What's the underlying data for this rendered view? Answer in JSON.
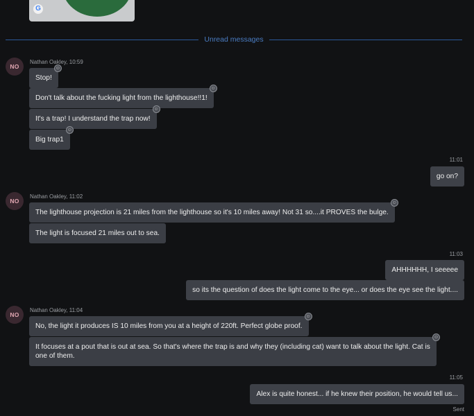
{
  "unread_label": "Unread messages",
  "top_card": {
    "icon": "G"
  },
  "groups": [
    {
      "avatar": "NO",
      "meta": "Nathan Oakley, 10:59",
      "messages": [
        "Stop!",
        "Don't talk about the fucking light from the lighthouse!!1!",
        "It's a trap! I understand the trap now!",
        "Big trap1"
      ]
    },
    {
      "time": "11:01",
      "messages": [
        "go on?"
      ]
    },
    {
      "avatar": "NO",
      "meta": "Nathan Oakley, 11:02",
      "messages": [
        "The lighthouse projection is 21 miles from the lighthouse so it's 10 miles away! Not 31 so....it PROVES the bulge.",
        "The light is focused 21 miles out to sea."
      ]
    },
    {
      "time": "11:03",
      "messages": [
        "AHHHHHH, I seeeee",
        "so its the question of does the light come to the eye... or does the eye see the light...."
      ]
    },
    {
      "avatar": "NO",
      "meta": "Nathan Oakley, 11:04",
      "messages": [
        "No, the light it produces IS 10 miles from you at a height of 220ft. Perfect globe proof.",
        "It focuses at a pout that is out at sea. So that's where the trap is and why they (including cat) want to talk about the light. Cat is one of them."
      ]
    },
    {
      "time": "11:05",
      "messages": [
        "Alex is quite honest... if he knew their position, he would tell us..."
      ],
      "status": "Sent"
    }
  ]
}
